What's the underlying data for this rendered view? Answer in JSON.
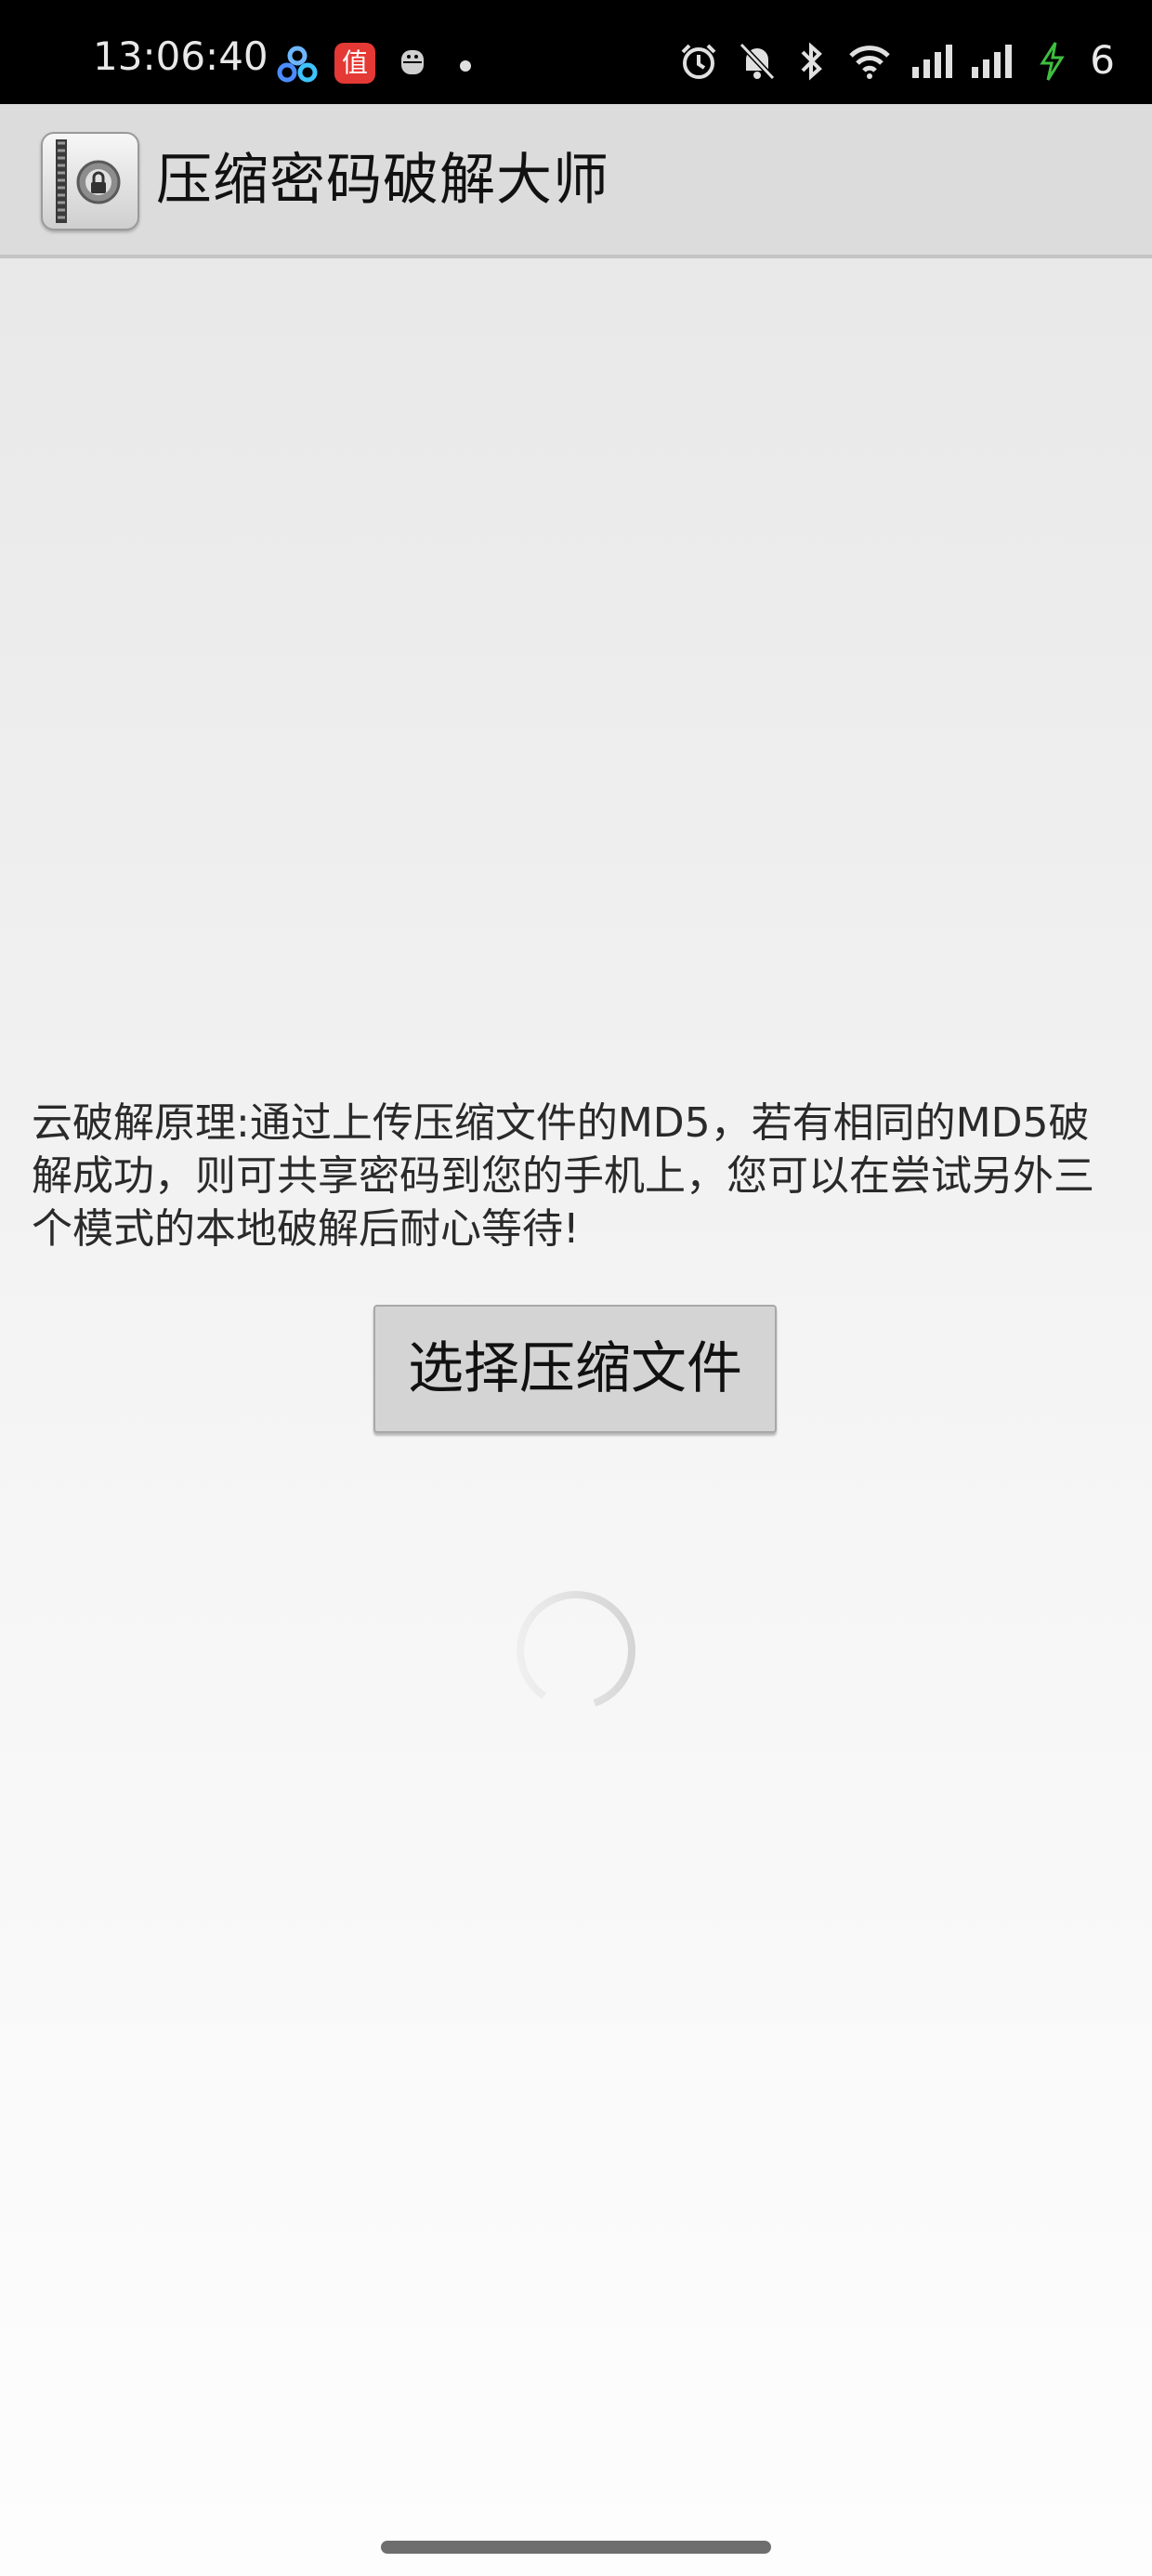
{
  "status_bar": {
    "time": "13:06:40",
    "left_icons": [
      "baidu-netdisk-icon",
      "zhi-app-icon",
      "android-bug-icon",
      "dot-icon"
    ],
    "zhi_app_glyph": "值",
    "right_icons": [
      "alarm-icon",
      "mute-icon",
      "bluetooth-icon",
      "wifi-icon",
      "signal-icon",
      "signal-icon",
      "charging-icon"
    ],
    "battery_level": "6"
  },
  "action_bar": {
    "title": "压缩密码破解大师",
    "icon": "archive-lock-icon"
  },
  "main": {
    "description": "云破解原理:通过上传压缩文件的MD5，若有相同的MD5破解成功，则可共享密码到您的手机上，您可以在尝试另外三个模式的本地破解后耐心等待!",
    "select_button_label": "选择压缩文件",
    "loading_indicator": "spinner-icon"
  },
  "colors": {
    "status_bar_bg": "#000000",
    "action_bar_bg": "#dcdcdc",
    "button_bg": "#d4d4d4",
    "charging_green": "#3fbf3f"
  }
}
